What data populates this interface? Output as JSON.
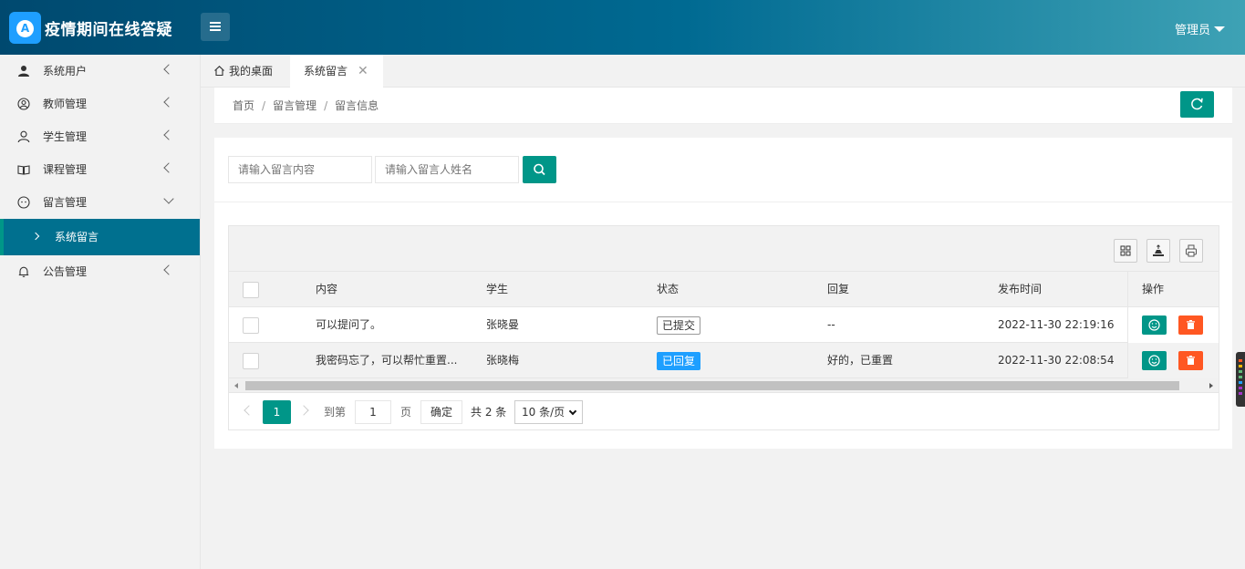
{
  "app": {
    "title": "疫情期间在线答疑",
    "logo_letter": "A"
  },
  "header": {
    "user": "管理员"
  },
  "sidebar": {
    "items": [
      {
        "label": "系统用户",
        "icon": "user-solid-icon"
      },
      {
        "label": "教师管理",
        "icon": "user-circle-icon"
      },
      {
        "label": "学生管理",
        "icon": "user-outline-icon"
      },
      {
        "label": "课程管理",
        "icon": "book-icon"
      },
      {
        "label": "留言管理",
        "icon": "face-icon",
        "expanded": true
      },
      {
        "label": "公告管理",
        "icon": "bell-icon"
      }
    ],
    "sub_item": {
      "label": "系统留言"
    }
  },
  "tabs": {
    "home": "我的桌面",
    "active": "系统留言",
    "close": "✕"
  },
  "breadcrumb": {
    "home": "首页",
    "level1": "留言管理",
    "level2": "留言信息",
    "sep": "/"
  },
  "search": {
    "content_placeholder": "请输入留言内容",
    "name_placeholder": "请输入留言人姓名"
  },
  "table": {
    "columns": {
      "content": "内容",
      "student": "学生",
      "status": "状态",
      "reply": "回复",
      "time": "发布时间",
      "ops": "操作"
    },
    "rows": [
      {
        "content": "可以提问了。",
        "student": "张晓曼",
        "status": "已提交",
        "reply": "--",
        "time": "2022-11-30 22:19:16"
      },
      {
        "content": "我密码忘了，可以帮忙重置...",
        "student": "张晓梅",
        "status": "已回复",
        "reply": "好的，已重置",
        "time": "2022-11-30 22:08:54"
      }
    ]
  },
  "pager": {
    "current": "1",
    "goto": "到第",
    "page_input": "1",
    "page_unit": "页",
    "confirm": "确定",
    "total": "共 2 条",
    "page_size": "10 条/页"
  },
  "colors": {
    "primary": "#009688",
    "danger": "#ff5722",
    "info": "#1e9fff",
    "sidebar_active": "#00708f"
  }
}
